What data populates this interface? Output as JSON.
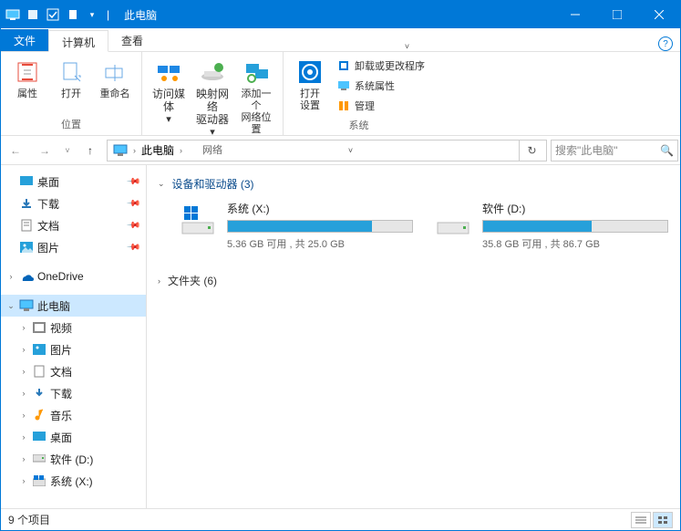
{
  "window": {
    "title": "此电脑"
  },
  "tabs": {
    "file": "文件",
    "computer": "计算机",
    "view": "查看"
  },
  "ribbon": {
    "location_group": "位置",
    "network_group": "网络",
    "system_group": "系统",
    "properties": "属性",
    "open": "打开",
    "rename": "重命名",
    "access_media": "访问媒体",
    "map_network": "映射网络\n驱动器",
    "add_network": "添加一个\n网络位置",
    "open_settings": "打开\n设置",
    "uninstall": "卸载或更改程序",
    "system_props": "系统属性",
    "manage": "管理"
  },
  "address": {
    "crumb": "此电脑"
  },
  "search": {
    "placeholder": "搜索\"此电脑\""
  },
  "nav": {
    "desktop": "桌面",
    "downloads": "下载",
    "documents": "文档",
    "pictures": "图片",
    "onedrive": "OneDrive",
    "thispc": "此电脑",
    "videos": "视频",
    "pictures2": "图片",
    "documents2": "文档",
    "downloads2": "下载",
    "music": "音乐",
    "desktop2": "桌面",
    "drive_d": "软件 (D:)",
    "drive_x": "系统 (X:)"
  },
  "sections": {
    "devices": "设备和驱动器 (3)",
    "folders": "文件夹 (6)"
  },
  "drives": [
    {
      "name": "系统 (X:)",
      "free_text": "5.36 GB 可用 , 共 25.0 GB",
      "used_pct": 78
    },
    {
      "name": "软件 (D:)",
      "free_text": "35.8 GB 可用 , 共 86.7 GB",
      "used_pct": 59
    }
  ],
  "status": {
    "items": "9 个项目"
  }
}
